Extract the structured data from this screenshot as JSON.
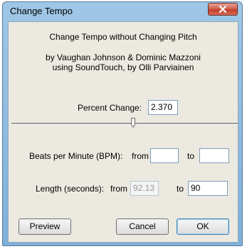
{
  "window": {
    "title": "Change Tempo"
  },
  "header": {
    "heading": "Change Tempo without Changing Pitch",
    "credit_line1": "by Vaughan Johnson & Dominic Mazzoni",
    "credit_line2": "using SoundTouch, by Olli Parviainen"
  },
  "percent_change": {
    "label": "Percent Change:",
    "value": "2.370",
    "slider_position_fraction": 0.54
  },
  "bpm": {
    "label": "Beats per Minute (BPM):",
    "from_label": "from",
    "from_value": "",
    "to_label": "to",
    "to_value": ""
  },
  "length": {
    "label": "Length (seconds):",
    "from_label": "from",
    "from_value": "92.13",
    "to_label": "to",
    "to_value": "90"
  },
  "buttons": {
    "preview": "Preview",
    "cancel": "Cancel",
    "ok": "OK"
  },
  "icons": {
    "close": "close-icon"
  }
}
